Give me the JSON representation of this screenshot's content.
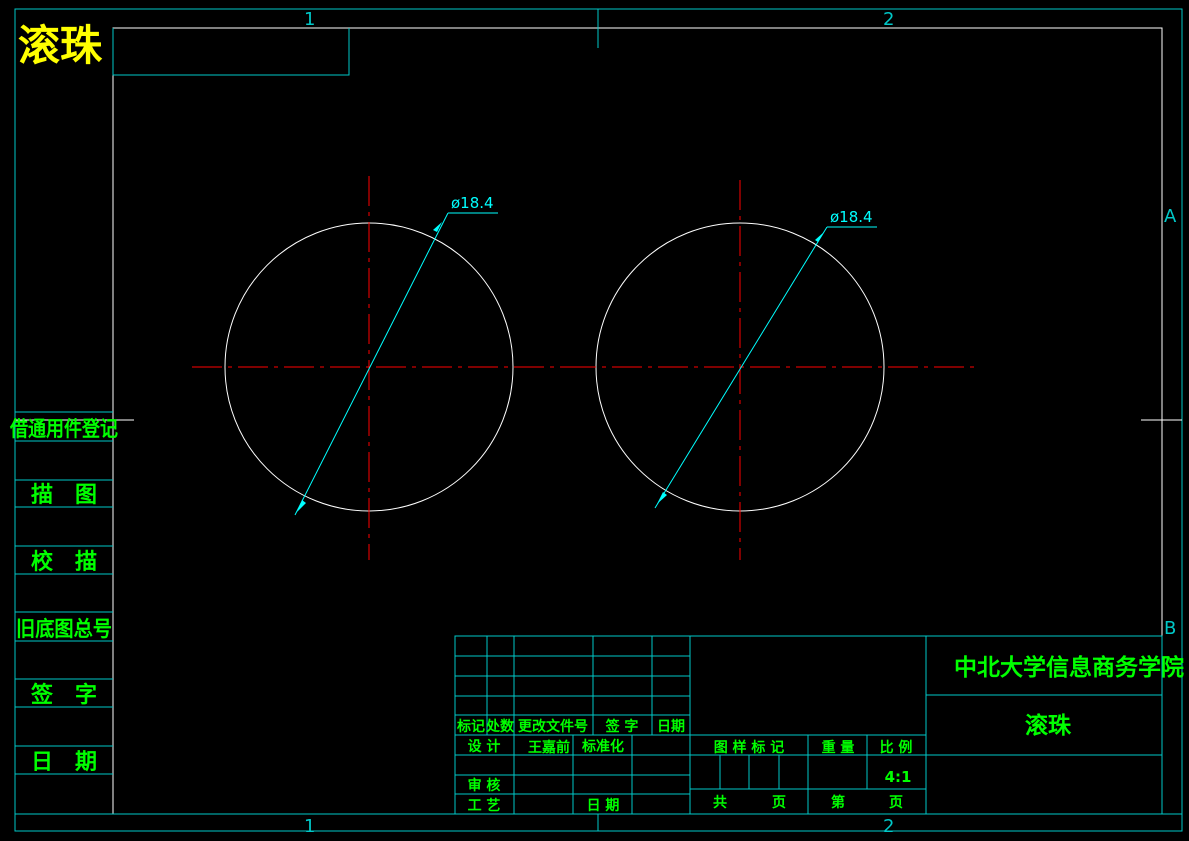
{
  "drawing": {
    "title": "滚珠",
    "colors": {
      "background": "#000000",
      "frame": "#00c8c8",
      "border": "#ffffff",
      "title_yellow": "#ffff00",
      "text_green": "#00ff00",
      "centerline": "#ff0000",
      "dimension": "#00ffff",
      "outline": "#ffffff"
    },
    "zone_markers": {
      "top": [
        "1",
        "2"
      ],
      "bottom": [
        "1",
        "2"
      ],
      "right": [
        "A",
        "B"
      ]
    },
    "side_panel": [
      "借通用件登记",
      "描　图",
      "校　描",
      "旧底图总号",
      "签　字",
      "日　期"
    ],
    "dimensions": [
      "ø18.4",
      "ø18.4"
    ]
  },
  "title_block": {
    "revision_header": [
      "标记",
      "处数",
      "更改文件号",
      "签 字",
      "日期"
    ],
    "row_design": [
      "设 计",
      "王嘉前",
      "标准化"
    ],
    "row_review": "审 核",
    "row_process": [
      "工 艺",
      "日 期"
    ],
    "mid_header": [
      "图 样 标 记",
      "重 量",
      "比 例"
    ],
    "scale": "4:1",
    "page_row": [
      "共",
      "页",
      "第",
      "页"
    ],
    "school": "中北大学信息商务学院",
    "part_name": "滚珠"
  }
}
